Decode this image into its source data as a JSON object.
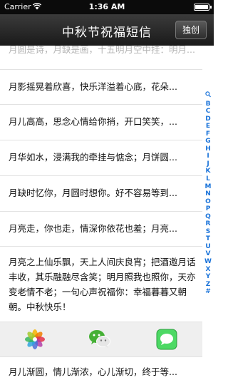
{
  "status": {
    "carrier": "Carrier",
    "time": "1:36 AM"
  },
  "nav": {
    "title": "中秋节祝福短信",
    "unique_button": "独创"
  },
  "messages": [
    {
      "text": "月圆是诗，月缺是画，十五明月空中挂：明月..."
    },
    {
      "text": "月影摇晃着欣喜，快乐洋溢着心底，花朵..."
    },
    {
      "text": "月儿高高，思念心情给你捎，开口笑笑，..."
    },
    {
      "text": "月华如水，浸满我的牵挂与惦念；月饼圆..."
    },
    {
      "text": "月缺时忆你，月圆时想你。好不容易等到..."
    },
    {
      "text": "月亮走，你也走，情深你依花也羞；月亮..."
    },
    {
      "text": "月亮之上仙乐飘，天上人间庆良宵；把酒邀月话丰收，其乐融融尽含笑；明月照我也照你，天亦变老情不老；一句心声祝福你：幸福暮暮又朝朝。中秋快乐！"
    },
    {
      "text": "月儿渐圆，情儿渐浓，心儿渐切，终于等..."
    }
  ],
  "share": {
    "items": [
      {
        "icon": "photos-app-icon"
      },
      {
        "icon": "wechat-icon"
      },
      {
        "icon": "messages-icon"
      }
    ]
  },
  "index_letters": [
    "Q",
    "B",
    "C",
    "D",
    "E",
    "F",
    "G",
    "H",
    "I",
    "J",
    "K",
    "L",
    "M",
    "N",
    "O",
    "P",
    "Q",
    "R",
    "S",
    "T",
    "U",
    "V",
    "W",
    "X",
    "Y",
    "Z",
    "#"
  ]
}
